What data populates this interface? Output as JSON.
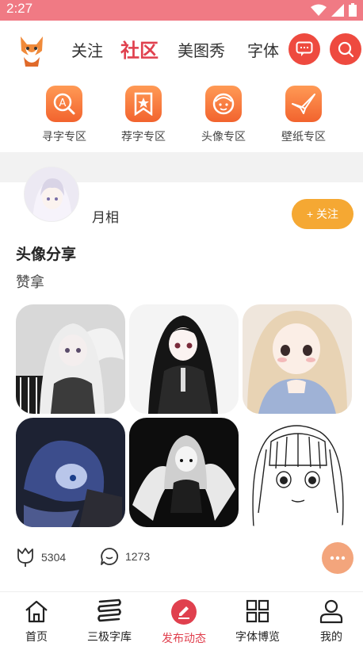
{
  "status_bar": {
    "time": "2:27"
  },
  "header": {
    "tabs": [
      {
        "label": "关注",
        "active": false
      },
      {
        "label": "社区",
        "active": true
      },
      {
        "label": "美图秀",
        "active": false
      },
      {
        "label": "字体",
        "active": false
      }
    ],
    "icons": [
      "message-icon",
      "search-icon"
    ]
  },
  "zones": [
    {
      "label": "寻字专区",
      "icon": "magnify-letter-icon"
    },
    {
      "label": "荐字专区",
      "icon": "bookmark-star-icon"
    },
    {
      "label": "头像专区",
      "icon": "avatar-face-icon"
    },
    {
      "label": "壁纸专区",
      "icon": "paper-crane-icon"
    }
  ],
  "post": {
    "username": "月相",
    "follow_label": "+ 关注",
    "title": "头像分享",
    "description": "赞拿",
    "likes": "5304",
    "comments": "1273"
  },
  "bottom_nav": [
    {
      "label": "首页",
      "icon": "home-icon",
      "active": false
    },
    {
      "label": "三极字库",
      "icon": "font-library-icon",
      "active": false
    },
    {
      "label": "发布动态",
      "icon": "publish-icon",
      "active": true
    },
    {
      "label": "字体博览",
      "icon": "grid-icon",
      "active": false
    },
    {
      "label": "我的",
      "icon": "profile-icon",
      "active": false
    }
  ],
  "colors": {
    "accent": "#e0404e",
    "status_bar": "#f07a84",
    "zone_orange": "#f2632e",
    "follow": "#f5a833"
  }
}
